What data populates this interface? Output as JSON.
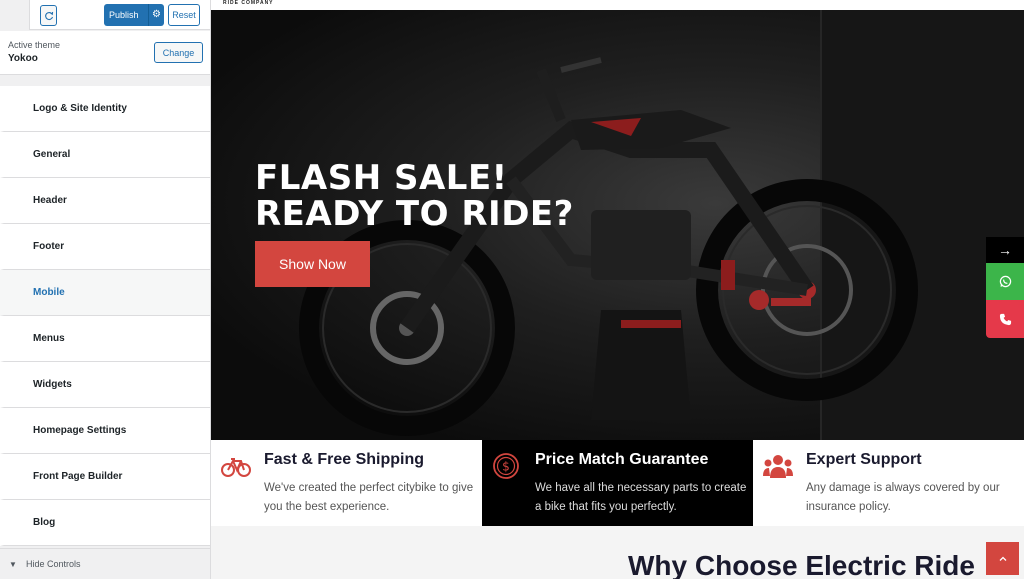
{
  "customizer": {
    "publish_label": "Publish",
    "reset_label": "Reset",
    "active_theme_label": "Active theme",
    "theme_name": "Yokoo",
    "change_label": "Change",
    "panels": [
      {
        "label": "Logo & Site Identity"
      },
      {
        "label": "General"
      },
      {
        "label": "Header"
      },
      {
        "label": "Footer"
      },
      {
        "label": "Mobile"
      },
      {
        "label": "Menus"
      },
      {
        "label": "Widgets"
      },
      {
        "label": "Homepage Settings"
      },
      {
        "label": "Front Page Builder"
      },
      {
        "label": "Blog"
      }
    ],
    "active_panel": "Mobile",
    "hide_controls_label": "Hide Controls"
  },
  "site": {
    "brand_tagline": "RIDE COMPANY",
    "hero": {
      "title_line1": "FLASH SALE!",
      "title_line2": "READY TO RIDE?",
      "button_label": "Show Now"
    },
    "features": [
      {
        "title": "Fast & Free Shipping",
        "desc": "We've created the perfect citybike to give you the best experience.",
        "icon": "bicycle-icon"
      },
      {
        "title": "Price Match Guarantee",
        "desc": "We have all the necessary parts to create a bike that fits you perfectly.",
        "icon": "dollar-coin-icon"
      },
      {
        "title": "Expert Support",
        "desc": "Any damage is always covered by our insurance policy.",
        "icon": "users-group-icon"
      }
    ],
    "section_title": "Why Choose Electric Ride",
    "float_arrow": "→"
  },
  "colors": {
    "accent_red": "#d3463f",
    "wp_blue": "#2271b1",
    "whatsapp_green": "#3cb54a",
    "phone_red": "#e5394a"
  }
}
